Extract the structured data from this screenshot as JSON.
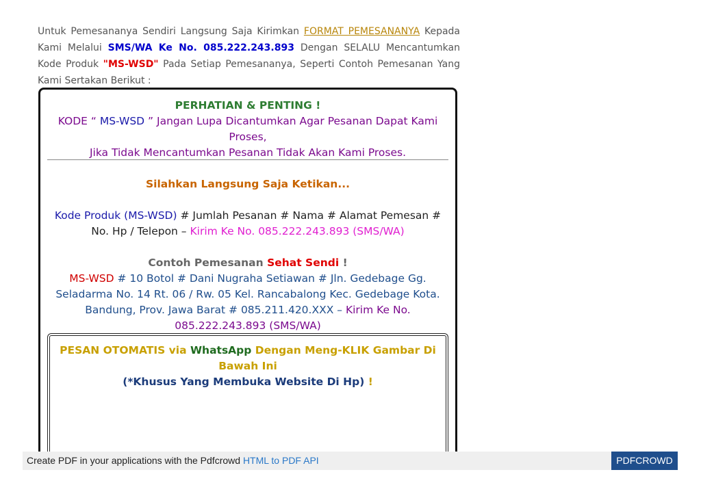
{
  "intro": {
    "t1": "Untuk Pemesananya Sendiri Langsung Saja Kirimkan ",
    "link": "FORMAT PEMESANANYA",
    "t2": " Kepada Kami Melalui ",
    "sms": "SMS/WA Ke No. 085.222.243.893",
    "t3": " Dengan SELALU Mencantumkan Kode Produk ",
    "code": "\"MS-WSD\"",
    "t4": " Pada Setiap Pemesananya, Seperti Contoh Pemesanan Yang Kami Sertakan Berikut :"
  },
  "box": {
    "heading": "PERHATIAN & PENTING !",
    "kode_prefix": "KODE “ ",
    "kode_code": "MS-WSD",
    "kode_rest": " ” Jangan Lupa Dicantumkan Agar Pesanan Dapat Kami Proses,",
    "line2": "Jika Tidak Mencantumkan Pesanan Tidak Akan Kami Proses.",
    "silahkan": "Silahkan Langsung Saja Ketikan...",
    "fmt_code": "Kode Produk (MS-WSD)",
    "fmt_rest": " # Jumlah Pesanan # Nama # Alamat Pemesan # No. Hp / Telepon – ",
    "fmt_send": "Kirim Ke No. 085.222.243.893 (SMS/WA)",
    "contoh": "Contoh Pemesanan ",
    "contoh_brand": "Sehat Sendi",
    "contoh_bang": " !",
    "ex_code": "MS-WSD",
    "ex_rest": " # 10 Botol # Dani Nugraha Setiawan # Jln. Gedebage Gg. Seladarma No. 14 Rt. 06 / Rw. 05 Kel. Rancabalong Kec. Gedebage Kota. Bandung, Prov. Jawa Barat # 085.211.420.XXX – ",
    "ex_send": "Kirim Ke No. 085.222.243.893 (SMS/WA)",
    "pesan1": "PESAN OTOMATIS via ",
    "pesan_wa": "WhatsApp",
    "pesan2": " Dengan Meng-KLIK Gambar Di Bawah Ini",
    "khusus": "(*Khusus Yang Membuka Website Di Hp)",
    "khusus_bang": " !"
  },
  "footer": {
    "text": "Create PDF in your applications with the Pdfcrowd ",
    "link": "HTML to PDF API",
    "brand": "PDFCROWD"
  }
}
